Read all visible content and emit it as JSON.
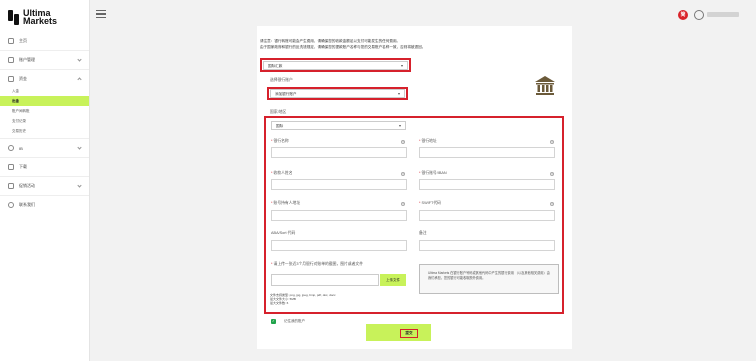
{
  "brand": {
    "name_line1": "Ultima",
    "name_line2": "Markets"
  },
  "sidebar": {
    "items": [
      {
        "label": "主页",
        "icon": "home-icon"
      },
      {
        "label": "账户管理",
        "icon": "chart-icon"
      },
      {
        "label": "资金",
        "icon": "wallet-icon"
      },
      {
        "label": "IB",
        "icon": "user-icon"
      },
      {
        "label": "下载",
        "icon": "download-icon"
      },
      {
        "label": "促销活动",
        "icon": "gift-icon"
      },
      {
        "label": "联系我们",
        "icon": "info-icon"
      }
    ],
    "fund_sub": [
      "入金",
      "出金",
      "账户间转账",
      "支付记录",
      "交易历史"
    ]
  },
  "header": {
    "flag_label": "简"
  },
  "form": {
    "intro_line1": "请注意：银行转账可能会产生费用，请确保您的收款金额足以支付可能发生的任何费用。",
    "intro_line2": "由于国家政府和银行的反洗钱规定，请确保您的提款账户名称与您的交易账户名称一致，否则将被退回。",
    "method_value": "国际汇款",
    "choose_account_label": "选择银行账户",
    "account_value": "添加银行账户",
    "country_label": "国家/地区",
    "country_value": "国际",
    "fields": {
      "bank_name": "银行名称",
      "bank_address": "银行地址",
      "beneficiary_name": "收款人姓名",
      "account_iban": "银行账号/IBAN",
      "holder_address": "账号持有人地址",
      "swift": "SWIFT代码",
      "aba_sort": "ABA/Sort 代码",
      "remarks": "备注"
    },
    "upload_label": "请上传一张近3个月银行对账单的截图，图片或者文件",
    "upload_button": "上传文件",
    "file_types": "文件支持类型: png, jpg, jpeg, bmp, pdf, doc, docx",
    "max_size": "最大文件大小: 5MB",
    "max_files": "最大文件数: 6",
    "info_text": "Ultima Markets 在银行账户号码或其他代码中产生的银行费用 （以及其他相关费用）由我们承担。您的银行可能收取额外费用。",
    "remember_label": "记住我的账户",
    "submit_label": "提交"
  },
  "colors": {
    "accent": "#c8f25a",
    "highlight": "#d6212c",
    "check": "#1fa34a"
  }
}
